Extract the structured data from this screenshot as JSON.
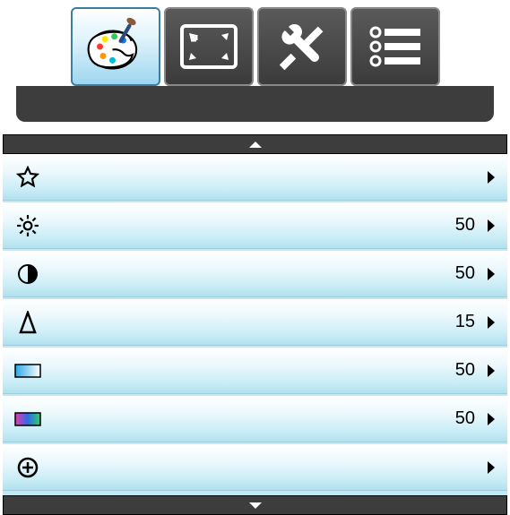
{
  "tabs": [
    {
      "id": "picture",
      "active": true
    },
    {
      "id": "screen",
      "active": false
    },
    {
      "id": "tools",
      "active": false
    },
    {
      "id": "list",
      "active": false
    }
  ],
  "menu": {
    "items": [
      {
        "id": "favorites",
        "value": ""
      },
      {
        "id": "brightness",
        "value": "50"
      },
      {
        "id": "contrast",
        "value": "50"
      },
      {
        "id": "sharpness",
        "value": "15"
      },
      {
        "id": "hue",
        "value": "50"
      },
      {
        "id": "saturation",
        "value": "50"
      },
      {
        "id": "advanced",
        "value": ""
      }
    ]
  }
}
